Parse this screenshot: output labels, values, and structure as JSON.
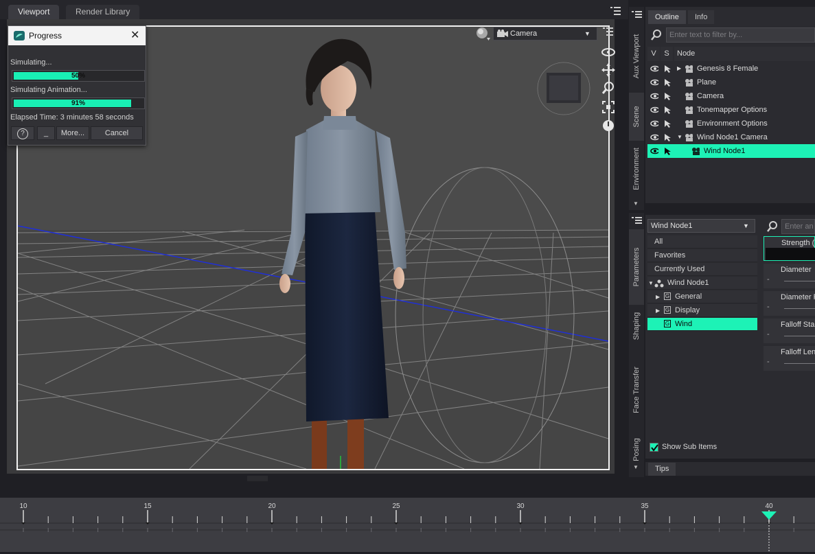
{
  "top_tabs": [
    {
      "label": "Viewport",
      "active": true
    },
    {
      "label": "Render Library",
      "active": false
    }
  ],
  "viewport": {
    "camera_select": "Camera"
  },
  "progress_dialog": {
    "title": "Progress",
    "simulating_label": "Simulating...",
    "simulating_progress": 50,
    "simulating_text": "50%",
    "animation_label": "Simulating Animation...",
    "animation_progress": 91,
    "animation_text": "91%",
    "elapsed": "Elapsed Time: 3 minutes 58 seconds",
    "buttons": {
      "help": "?",
      "minimize": "_",
      "more": "More...",
      "cancel": "Cancel"
    }
  },
  "left_side_tabs": [
    "Aux Viewport",
    "Scene",
    "Environment"
  ],
  "left_side_tabs_2": [
    "Parameters",
    "Shaping",
    "Face Transfer",
    "Posing"
  ],
  "outline": {
    "tabs": [
      {
        "label": "Outline",
        "active": true
      },
      {
        "label": "Info",
        "active": false
      }
    ],
    "filter_placeholder": "Enter text to filter by...",
    "headers": {
      "v": "V",
      "s": "S",
      "node": "Node"
    },
    "rows": [
      {
        "label": "Genesis 8 Female",
        "icon": "figure-icon",
        "selected": false
      },
      {
        "label": "Plane",
        "icon": "primitive-icon",
        "selected": false
      },
      {
        "label": "Camera",
        "icon": "camera-icon",
        "selected": false
      },
      {
        "label": "Tonemapper Options",
        "icon": "tonemapper-icon",
        "selected": false
      },
      {
        "label": "Environment Options",
        "icon": "environment-icon",
        "selected": false
      },
      {
        "label": "Wind Node1 Camera",
        "icon": "camera-icon",
        "selected": false
      },
      {
        "label": "Wind Node1",
        "icon": "wind-node-icon",
        "selected": true
      }
    ]
  },
  "parameters": {
    "node_select": "Wind Node1",
    "filter_placeholder": "Enter an",
    "tree": [
      {
        "label": "All",
        "selected": false
      },
      {
        "label": "Favorites",
        "selected": false
      },
      {
        "label": "Currently Used",
        "selected": false
      },
      {
        "label": "Wind Node1",
        "selected": false
      },
      {
        "label": "General",
        "selected": false
      },
      {
        "label": "Display",
        "selected": false
      },
      {
        "label": "Wind",
        "selected": true
      }
    ],
    "properties": [
      "Strength (",
      "Diameter",
      "Diameter F",
      "Falloff Sta",
      "Falloff Len"
    ],
    "show_sub_items": "Show Sub Items",
    "show_sub_items_checked": true
  },
  "tips_tab": "Tips",
  "timeline": {
    "ticks": [
      "10",
      "15",
      "20",
      "25",
      "30",
      "35",
      "40"
    ],
    "current_frame": 40
  },
  "colors": {
    "accent": "#1df2b6",
    "viewport_bg": "#4a4a4a",
    "panel_bg": "#2b2b30"
  }
}
